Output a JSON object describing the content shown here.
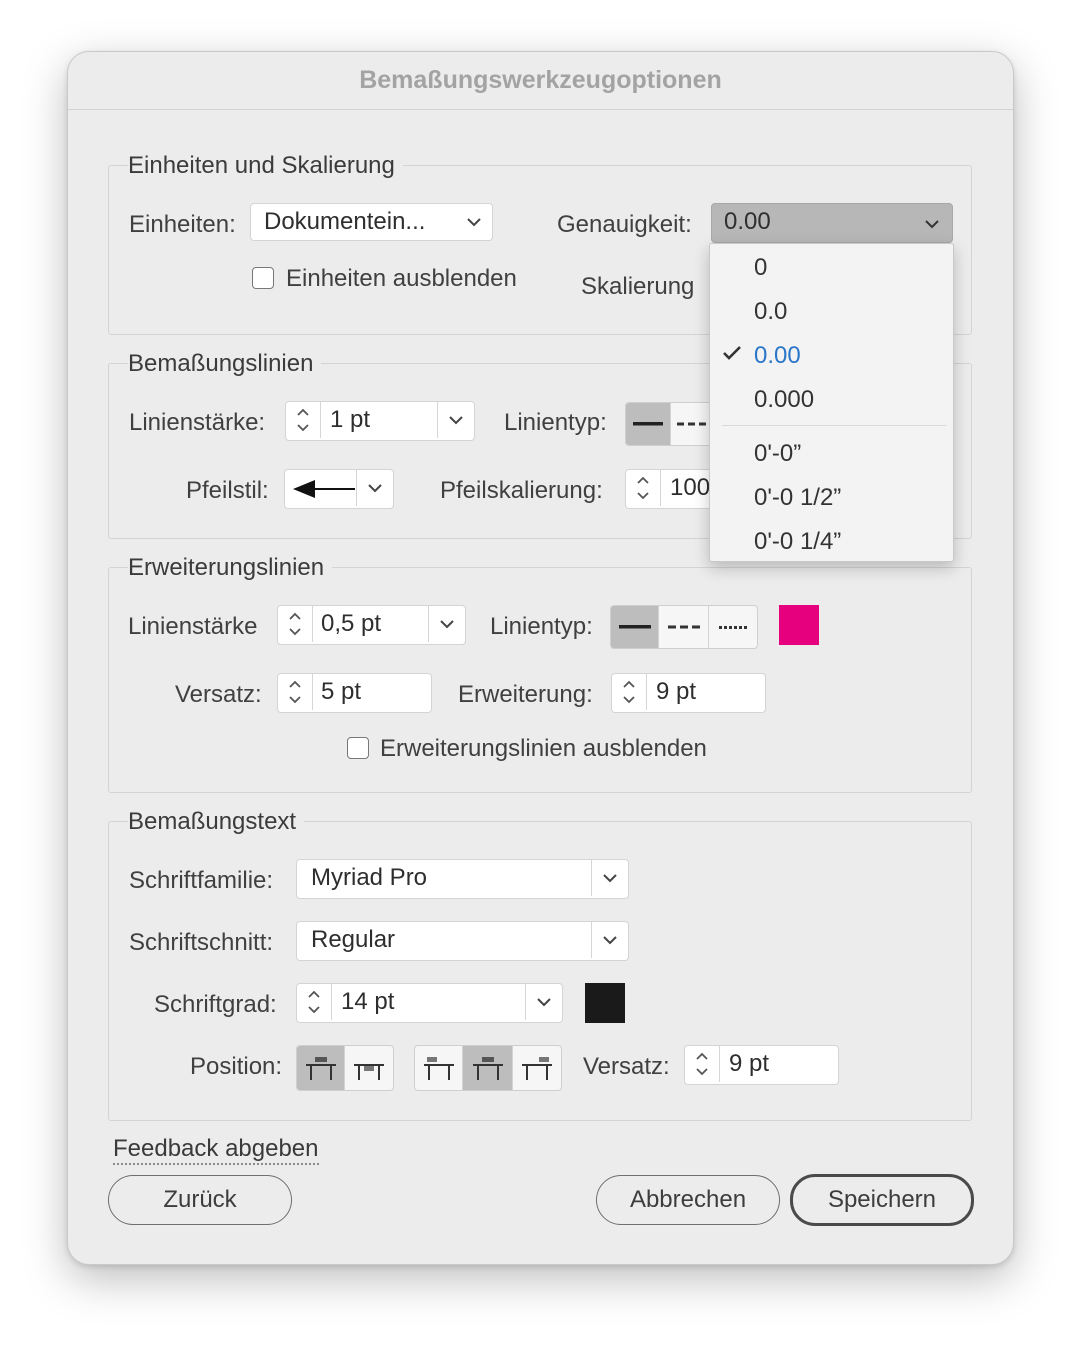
{
  "window": {
    "title": "Bemaßungswerkzeugoptionen"
  },
  "units_section": {
    "title": "Einheiten und Skalierung",
    "units_label": "Einheiten:",
    "units_value": "Dokumentein...",
    "precision_label": "Genauigkeit:",
    "precision_value": "0.00",
    "hide_units_label": "Einheiten ausblenden",
    "hide_units_checked": false,
    "scale_label": "Skalierung"
  },
  "precision_menu": {
    "items": [
      "0",
      "0.0",
      "0.00",
      "0.000",
      "0'-0”",
      "0'-0 1/2”",
      "0'-0 1/4”"
    ],
    "selected_index": 2,
    "selected_color": "#2a76c9"
  },
  "dimension_lines": {
    "title": "Bemaßungslinien",
    "stroke_label": "Linienstärke:",
    "stroke_value": "1 pt",
    "linetype_label": "Linientyp:",
    "arrow_label": "Pfeilstil:",
    "arrow_scale_label": "Pfeilskalierung:",
    "arrow_scale_value": "100"
  },
  "extension_lines": {
    "title": "Erweiterungslinien",
    "stroke_label": "Linienstärke",
    "stroke_value": "0,5 pt",
    "linetype_label": "Linientyp:",
    "color": "#e6007e",
    "offset_label": "Versatz:",
    "offset_value": "5 pt",
    "extension_label": "Erweiterung:",
    "extension_value": "9 pt",
    "hide_label": "Erweiterungslinien ausblenden",
    "hide_checked": false
  },
  "dimension_text": {
    "title": "Bemaßungstext",
    "font_family_label": "Schriftfamilie:",
    "font_family_value": "Myriad Pro",
    "font_style_label": "Schriftschnitt:",
    "font_style_value": "Regular",
    "font_size_label": "Schriftgrad:",
    "font_size_value": "14 pt",
    "text_color": "#1a1a1a",
    "position_label": "Position:",
    "offset_label": "Versatz:",
    "offset_value": "9 pt"
  },
  "footer": {
    "feedback_link": "Feedback abgeben",
    "back_button": "Zurück",
    "cancel_button": "Abbrechen",
    "save_button": "Speichern"
  }
}
